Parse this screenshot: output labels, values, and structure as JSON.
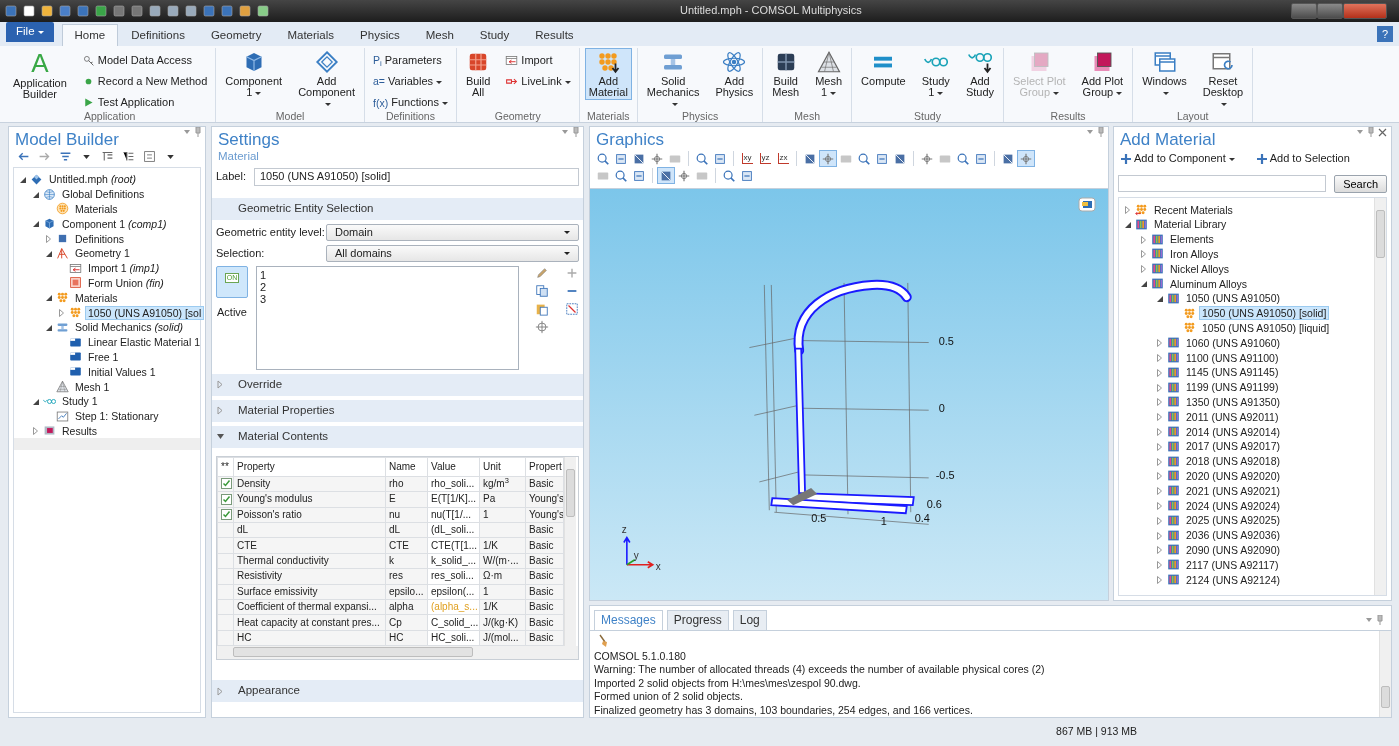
{
  "window": {
    "title": "Untitled.mph - COMSOL Multiphysics"
  },
  "ribbon": {
    "file_menu": "File",
    "tabs": [
      {
        "label": "Home",
        "selected": true
      },
      {
        "label": "Definitions",
        "selected": false
      },
      {
        "label": "Geometry",
        "selected": false
      },
      {
        "label": "Materials",
        "selected": false
      },
      {
        "label": "Physics",
        "selected": false
      },
      {
        "label": "Mesh",
        "selected": false
      },
      {
        "label": "Study",
        "selected": false
      },
      {
        "label": "Results",
        "selected": false
      }
    ],
    "help": "?",
    "groups": [
      {
        "label": "Application",
        "items": [
          {
            "kind": "large",
            "glyph": "A",
            "label": "Application Builder",
            "dropdown": false,
            "selected": false,
            "disabled": false
          },
          {
            "kind": "small",
            "label": "Model Data Access",
            "dropdown": false,
            "selected": false,
            "disabled": false
          },
          {
            "kind": "small",
            "label": "Record a New Method",
            "dropdown": false,
            "selected": false,
            "disabled": false
          },
          {
            "kind": "small",
            "label": "Test Application",
            "dropdown": false,
            "selected": false,
            "disabled": false
          }
        ]
      },
      {
        "label": "Model",
        "items": [
          {
            "kind": "large",
            "label": "Component 1",
            "dropdown": true,
            "selected": false,
            "disabled": false
          },
          {
            "kind": "large",
            "label": "Add Component",
            "dropdown": true,
            "selected": false,
            "disabled": false
          }
        ]
      },
      {
        "label": "Definitions",
        "items": [
          {
            "kind": "small",
            "glyph": "P$_{i}$",
            "label": "Parameters",
            "dropdown": false,
            "selected": false,
            "disabled": false
          },
          {
            "kind": "small",
            "glyph": "a=",
            "label": "Variables",
            "dropdown": true,
            "selected": false,
            "disabled": false
          },
          {
            "kind": "small",
            "glyph": "f(x)",
            "label": "Functions",
            "dropdown": true,
            "selected": false,
            "disabled": false
          }
        ]
      },
      {
        "label": "Geometry",
        "items": [
          {
            "kind": "large",
            "label": "Build All",
            "dropdown": false,
            "selected": false,
            "disabled": false
          },
          {
            "kind": "small",
            "label": "Import",
            "dropdown": false,
            "selected": false,
            "disabled": false
          },
          {
            "kind": "small",
            "label": "LiveLink",
            "dropdown": true,
            "selected": false,
            "disabled": false
          }
        ]
      },
      {
        "label": "Materials",
        "items": [
          {
            "kind": "large",
            "label": "Add Material",
            "dropdown": false,
            "selected": true,
            "disabled": false
          }
        ]
      },
      {
        "label": "Physics",
        "items": [
          {
            "kind": "large",
            "label": "Solid Mechanics",
            "dropdown": true,
            "selected": false,
            "disabled": false
          },
          {
            "kind": "large",
            "label": "Add Physics",
            "dropdown": false,
            "selected": false,
            "disabled": false
          }
        ]
      },
      {
        "label": "Mesh",
        "items": [
          {
            "kind": "large",
            "label": "Build Mesh",
            "dropdown": false,
            "selected": false,
            "disabled": false
          },
          {
            "kind": "large",
            "label": "Mesh 1",
            "dropdown": true,
            "selected": false,
            "disabled": false
          }
        ]
      },
      {
        "label": "Study",
        "items": [
          {
            "kind": "large",
            "label": "Compute",
            "dropdown": false,
            "selected": false,
            "disabled": false
          },
          {
            "kind": "large",
            "label": "Study 1",
            "dropdown": true,
            "selected": false,
            "disabled": false
          },
          {
            "kind": "large",
            "label": "Add Study",
            "dropdown": false,
            "selected": false,
            "disabled": false
          }
        ]
      },
      {
        "label": "Results",
        "items": [
          {
            "kind": "large",
            "label": "Select Plot Group",
            "dropdown": true,
            "selected": false,
            "disabled": true
          },
          {
            "kind": "large",
            "label": "Add Plot Group",
            "dropdown": true,
            "selected": false,
            "disabled": false
          }
        ]
      },
      {
        "label": "Layout",
        "items": [
          {
            "kind": "large",
            "label": "Windows",
            "dropdown": true,
            "selected": false,
            "disabled": false
          },
          {
            "kind": "large",
            "label": "Reset Desktop",
            "dropdown": true,
            "selected": false,
            "disabled": false
          }
        ]
      }
    ]
  },
  "model_builder": {
    "title": "Model Builder",
    "tree": [
      {
        "label": "Untitled.mph *(root)*",
        "kind": "root",
        "expanded": true,
        "selected": false,
        "children": [
          {
            "label": "Global Definitions",
            "kind": "globe",
            "expanded": true,
            "selected": false,
            "children": [
              {
                "label": "Materials",
                "kind": "matglobal",
                "selected": false
              }
            ]
          },
          {
            "label": "Component 1 *(comp1)*",
            "kind": "component",
            "expanded": true,
            "selected": false,
            "children": [
              {
                "label": "Definitions",
                "kind": "definitions",
                "expanded": false,
                "selected": false
              },
              {
                "label": "Geometry 1",
                "kind": "geometry",
                "expanded": true,
                "selected": false,
                "children": [
                  {
                    "label": "Import 1 *(imp1)*",
                    "kind": "import",
                    "selected": false
                  },
                  {
                    "label": "Form Union *(fin)*",
                    "kind": "union",
                    "selected": false
                  }
                ]
              },
              {
                "label": "Materials",
                "kind": "materials",
                "expanded": true,
                "selected": false,
                "children": [
                  {
                    "label": "1050 (UNS A91050) [sol",
                    "kind": "material",
                    "expanded": false,
                    "selected": true
                  }
                ]
              },
              {
                "label": "Solid Mechanics *(solid)*",
                "kind": "physics",
                "expanded": true,
                "selected": false,
                "children": [
                  {
                    "label": "Linear Elastic Material 1",
                    "kind": "feature",
                    "selected": false
                  },
                  {
                    "label": "Free 1",
                    "kind": "feature",
                    "selected": false
                  },
                  {
                    "label": "Initial Values 1",
                    "kind": "feature",
                    "selected": false
                  }
                ]
              },
              {
                "label": "Mesh 1",
                "kind": "mesh",
                "selected": false
              }
            ]
          },
          {
            "label": "Study 1",
            "kind": "study",
            "expanded": true,
            "selected": false,
            "children": [
              {
                "label": "Step 1: Stationary",
                "kind": "step",
                "selected": false
              }
            ]
          },
          {
            "label": "Results",
            "kind": "results",
            "expanded": false,
            "selected": false
          }
        ]
      }
    ]
  },
  "settings": {
    "title": "Settings",
    "subtitle": "Material",
    "label_field": {
      "label": "Label:",
      "value": "1050 (UNS A91050) [solid]"
    },
    "sections": [
      {
        "kind": "selection",
        "title": "Geometric Entity Selection",
        "fields": [
          {
            "label": "Geometric entity level:",
            "value": "Domain"
          },
          {
            "label": "Selection:",
            "value": "All domains"
          }
        ],
        "toggle": {
          "glyph": "ON",
          "label": "Active",
          "on": true
        },
        "list": [
          "1",
          "2",
          "3"
        ]
      },
      {
        "kind": "header",
        "title": "Override",
        "expanded": false
      },
      {
        "kind": "header",
        "title": "Material Properties",
        "expanded": false
      },
      {
        "kind": "table",
        "title": "Material Contents",
        "expanded": true,
        "columns": [
          "**",
          "Property",
          "Name",
          "Value",
          "Unit",
          "Propert"
        ],
        "rows": [
          {
            "checked": true,
            "property": "Density",
            "name": "rho",
            "value": "rho_soli...",
            "derived": false,
            "unit": "kg/m$^{3}$",
            "group": "Basic"
          },
          {
            "checked": true,
            "property": "Young's modulus",
            "name": "E",
            "value": "E(T[1/K]...",
            "derived": false,
            "unit": "Pa",
            "group": "Young's"
          },
          {
            "checked": true,
            "property": "Poisson's ratio",
            "name": "nu",
            "value": "nu(T[1/...",
            "derived": false,
            "unit": "1",
            "group": "Young's"
          },
          {
            "checked": false,
            "property": "dL",
            "name": "dL",
            "value": "(dL_soli...",
            "derived": false,
            "group": "Basic"
          },
          {
            "checked": false,
            "property": "CTE",
            "name": "CTE",
            "value": "CTE(T[1...",
            "derived": false,
            "unit": "1/K",
            "group": "Basic"
          },
          {
            "checked": false,
            "property": "Thermal conductivity",
            "name": "k",
            "value": "k_solid_...",
            "derived": false,
            "unit": "W/(m·...",
            "group": "Basic"
          },
          {
            "checked": false,
            "property": "Resistivity",
            "name": "res",
            "value": "res_soli...",
            "derived": false,
            "unit": "Ω·m",
            "group": "Basic"
          },
          {
            "checked": false,
            "property": "Surface emissivity",
            "name": "epsilo...",
            "value": "epsilon(...",
            "derived": false,
            "unit": "1",
            "group": "Basic"
          },
          {
            "checked": false,
            "property": "Coefficient of thermal expansi...",
            "name": "alpha",
            "value": "(alpha_s...",
            "derived": true,
            "unit": "1/K",
            "group": "Basic"
          },
          {
            "checked": false,
            "property": "Heat capacity at constant pres...",
            "name": "Cp",
            "value": "C_solid_...",
            "derived": false,
            "unit": "J/(kg·K)",
            "group": "Basic"
          },
          {
            "checked": false,
            "property": "HC",
            "name": "HC",
            "value": "HC_soli...",
            "derived": false,
            "unit": "J/(mol...",
            "group": "Basic"
          }
        ]
      },
      {
        "kind": "header",
        "title": "Appearance",
        "expanded": false
      }
    ]
  },
  "graphics": {
    "title": "Graphics",
    "toolbar_rows": [
      [
        [
          {
            "selected": false
          },
          {
            "selected": false
          },
          {
            "selected": false
          },
          {
            "selected": false
          },
          {
            "selected": false
          }
        ],
        [
          {
            "selected": false
          },
          {
            "selected": false
          }
        ],
        [
          {
            "selected": false,
            "glyph": "xy"
          },
          {
            "selected": false,
            "glyph": "yz"
          },
          {
            "selected": false,
            "glyph": "zx"
          }
        ],
        [
          {
            "selected": false
          },
          {
            "selected": true
          },
          {
            "selected": false
          },
          {
            "selected": false
          },
          {
            "selected": false
          },
          {
            "selected": false
          }
        ],
        [
          {
            "selected": false
          },
          {
            "selected": false
          },
          {
            "selected": false
          },
          {
            "selected": false
          }
        ],
        [
          {
            "selected": false
          },
          {
            "selected": true
          }
        ]
      ],
      [
        [
          {
            "selected": false
          },
          {
            "selected": false
          },
          {
            "selected": false
          }
        ],
        [
          {
            "selected": true
          },
          {
            "selected": false
          },
          {
            "selected": false
          }
        ],
        [
          {
            "selected": false
          },
          {
            "selected": false
          }
        ]
      ]
    ],
    "tick_labels": [
      "0.5",
      "0",
      "-0.5",
      "0.5",
      "1",
      "0.4",
      "0.6"
    ],
    "axes": [
      "z",
      "y",
      "x"
    ]
  },
  "add_material": {
    "title": "Add Material",
    "actions": [
      {
        "label": "Add to Component",
        "dropdown": true
      },
      {
        "label": "Add to Selection",
        "dropdown": false
      }
    ],
    "search_button": "Search",
    "tree": [
      {
        "label": "Recent Materials",
        "kind": "recent",
        "expanded": false,
        "selected": false
      },
      {
        "label": "Material Library",
        "kind": "library",
        "expanded": true,
        "selected": false,
        "children": [
          {
            "label": "Elements",
            "kind": "library",
            "expanded": false,
            "selected": false
          },
          {
            "label": "Iron Alloys",
            "kind": "library",
            "expanded": false,
            "selected": false
          },
          {
            "label": "Nickel Alloys",
            "kind": "library",
            "expanded": false,
            "selected": false
          },
          {
            "label": "Aluminum Alloys",
            "kind": "library",
            "expanded": true,
            "selected": false,
            "children": [
              {
                "label": "1050 (UNS A91050)",
                "kind": "library",
                "expanded": true,
                "selected": false,
                "children": [
                  {
                    "label": "1050 (UNS A91050) [solid]",
                    "kind": "material",
                    "selected": true
                  },
                  {
                    "label": "1050 (UNS A91050) [liquid]",
                    "kind": "material",
                    "selected": false
                  }
                ]
              },
              {
                "label": "1060 (UNS A91060)",
                "kind": "library",
                "expanded": false,
                "selected": false
              },
              {
                "label": "1100 (UNS A91100)",
                "kind": "library",
                "expanded": false,
                "selected": false
              },
              {
                "label": "1145 (UNS A91145)",
                "kind": "library",
                "expanded": false,
                "selected": false
              },
              {
                "label": "1199 (UNS A91199)",
                "kind": "library",
                "expanded": false,
                "selected": false
              },
              {
                "label": "1350 (UNS A91350)",
                "kind": "library",
                "expanded": false,
                "selected": false
              },
              {
                "label": "2011 (UNS A92011)",
                "kind": "library",
                "expanded": false,
                "selected": false
              },
              {
                "label": "2014 (UNS A92014)",
                "kind": "library",
                "expanded": false,
                "selected": false
              },
              {
                "label": "2017 (UNS A92017)",
                "kind": "library",
                "expanded": false,
                "selected": false
              },
              {
                "label": "2018 (UNS A92018)",
                "kind": "library",
                "expanded": false,
                "selected": false
              },
              {
                "label": "2020 (UNS A92020)",
                "kind": "library",
                "expanded": false,
                "selected": false
              },
              {
                "label": "2021 (UNS A92021)",
                "kind": "library",
                "expanded": false,
                "selected": false
              },
              {
                "label": "2024 (UNS A92024)",
                "kind": "library",
                "expanded": false,
                "selected": false
              },
              {
                "label": "2025 (UNS A92025)",
                "kind": "library",
                "expanded": false,
                "selected": false
              },
              {
                "label": "2036 (UNS A92036)",
                "kind": "library",
                "expanded": false,
                "selected": false
              },
              {
                "label": "2090 (UNS A92090)",
                "kind": "library",
                "expanded": false,
                "selected": false
              },
              {
                "label": "2117 (UNS A92117)",
                "kind": "library",
                "expanded": false,
                "selected": false
              },
              {
                "label": "2124 (UNS A92124)",
                "kind": "library",
                "expanded": false,
                "selected": false
              }
            ]
          }
        ]
      }
    ]
  },
  "messages": {
    "tabs": [
      {
        "label": "Messages",
        "selected": true
      },
      {
        "label": "Progress",
        "selected": false
      },
      {
        "label": "Log",
        "selected": false
      }
    ],
    "lines": [
      "COMSOL 5.1.0.180",
      "Warning: The number of allocated threads (4) exceeds the number of available physical cores (2)",
      "Imported 2 solid objects from H:\\mes\\mes\\zespol 90.dwg.",
      "Formed union of 2 solid objects.",
      "Finalized geometry has 3 domains, 103 boundaries, 254 edges, and 166 vertices."
    ]
  },
  "status_bar": {
    "memory": "867 MB | 913 MB"
  }
}
